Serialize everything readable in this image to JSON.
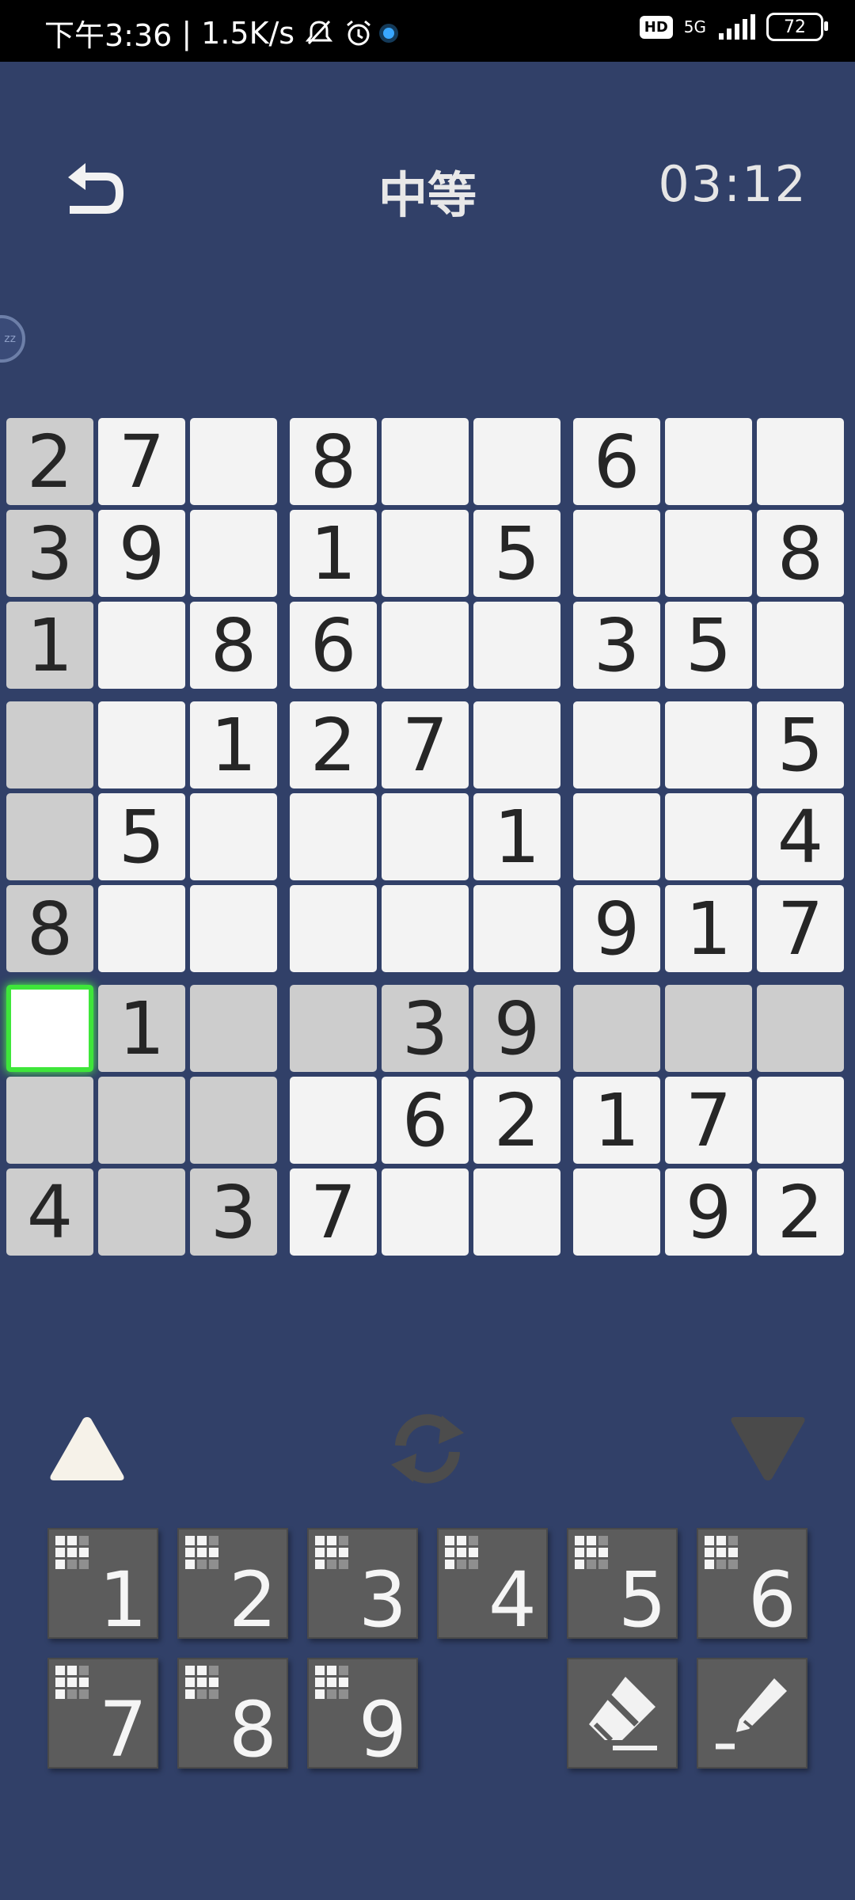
{
  "status_bar": {
    "time": "下午3:36",
    "net_speed": "1.5K/s",
    "hd": "HD",
    "network": "5G",
    "battery": "72"
  },
  "header": {
    "difficulty": "中等",
    "timer": "03:12"
  },
  "bubble": {
    "label": "zz"
  },
  "board": {
    "rows": [
      [
        "2",
        "7",
        "",
        "8",
        "",
        "",
        "6",
        "",
        ""
      ],
      [
        "3",
        "9",
        "",
        "1",
        "",
        "5",
        "",
        "",
        "8"
      ],
      [
        "1",
        "",
        "8",
        "6",
        "",
        "",
        "3",
        "5",
        ""
      ],
      [
        "",
        "",
        "1",
        "2",
        "7",
        "",
        "",
        "",
        "5"
      ],
      [
        "",
        "5",
        "",
        "",
        "",
        "1",
        "",
        "",
        "4"
      ],
      [
        "8",
        "",
        "",
        "",
        "",
        "",
        "9",
        "1",
        "7"
      ],
      [
        "",
        "1",
        "",
        "",
        "3",
        "9",
        "",
        "",
        ""
      ],
      [
        "",
        "",
        "",
        "",
        "6",
        "2",
        "1",
        "7",
        ""
      ],
      [
        "4",
        "",
        "3",
        "7",
        "",
        "",
        "",
        "9",
        "2"
      ]
    ],
    "selected": [
      6,
      0
    ]
  },
  "keypad": {
    "numbers": [
      "1",
      "2",
      "3",
      "4",
      "5",
      "6",
      "7",
      "8",
      "9"
    ]
  },
  "icons": {
    "back": "back-arrow-icon",
    "up": "triangle-up-icon",
    "refresh": "refresh-icon",
    "down": "triangle-down-icon",
    "eraser": "eraser-icon",
    "pencil": "pencil-icon"
  },
  "colors": {
    "background": "#314068",
    "cell": "#f3f3f3",
    "highlight": "#cdcdcd",
    "selected_border": "#3ee63a",
    "key": "#5c5c5c"
  }
}
